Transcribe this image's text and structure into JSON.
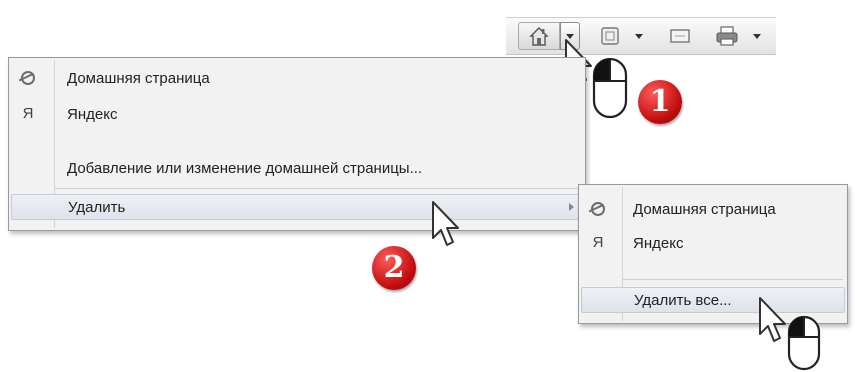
{
  "toolbar": {
    "buttons": [
      {
        "icon": "home-icon"
      },
      {
        "icon": "chevron-down-icon"
      },
      {
        "icon": "feeds-icon"
      },
      {
        "icon": "chevron-down-icon"
      },
      {
        "icon": "mail-icon"
      },
      {
        "icon": "print-icon"
      },
      {
        "icon": "chevron-down-icon"
      }
    ]
  },
  "home_menu": {
    "items": [
      {
        "label": "Домашняя страница",
        "icon": "ie-icon"
      },
      {
        "label": "Яндекс",
        "icon": "Я"
      },
      {
        "label": "Добавление или изменение домашней страницы..."
      },
      {
        "label": "Удалить",
        "has_submenu": true,
        "highlighted": true
      }
    ]
  },
  "remove_submenu": {
    "items": [
      {
        "label": "Домашняя страница",
        "icon": "ie-icon"
      },
      {
        "label": "Яндекс",
        "icon": "Я"
      },
      {
        "label": "Удалить все...",
        "highlighted": true
      }
    ]
  },
  "callouts": {
    "step1": "1",
    "step2": "2"
  },
  "colors": {
    "badge": "#c10d0d",
    "menu_bg": "#f2f2f2",
    "highlight": "#dde3ea"
  }
}
